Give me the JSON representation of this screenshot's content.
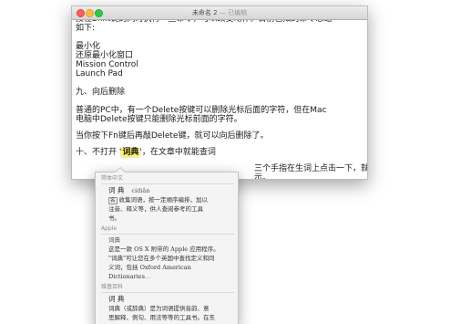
{
  "window": {
    "title": "未命名 2",
    "edited_label": "— 已编辑"
  },
  "document": {
    "lines": {
      "l1": "按住Shift键的同时执行一些命令，可以改变动作。目前已知的命令总结",
      "l2": "如下:",
      "l3": "最小化",
      "l4": "还原最小化窗口",
      "l5": "Mission Control",
      "l6": "Launch Pad",
      "l7": "九、向后删除",
      "l8": "普通的PC中，有一个Delete按键可以删除光标后面的字符，但在Mac",
      "l9": "电脑中Delete按键只能删除光标前面的字符。",
      "l10": "当你按下Fn键后再敲Delete键，就可以向后删除了。",
      "l11_before": "十、不打开 '",
      "l11_word": "词典",
      "l11_after": "'，在文章中就能查词",
      "l12_tail": "三个手指在生词上点击一下，就能显",
      "l13_tail": "示。"
    }
  },
  "popover": {
    "sections": {
      "s1": {
        "header": "简体中文",
        "word": "词 典",
        "pinyin": "cídiǎn",
        "def_num": "名",
        "def_line1": "收集词语，按一定顺序编排，加以",
        "def_line2": "注音、释义等，供人查阅参考的工具",
        "def_line3": "书。"
      },
      "s2": {
        "header": "Apple",
        "word": "词典",
        "line1": "这是一款 OS X 附带的 Apple 应用程序。",
        "line2": "\"词典\"可让您在多个英国中查找定义和同",
        "line3": "义词，包括 Oxford American Dictionaries",
        "ellipsis": "..."
      },
      "s3": {
        "header": "维基百科",
        "word": "词 典",
        "line1": "词典（或辞典）是为词语提供音韵、意",
        "line2": "思解释、例句、用法等等的工具书。在东"
      }
    }
  }
}
